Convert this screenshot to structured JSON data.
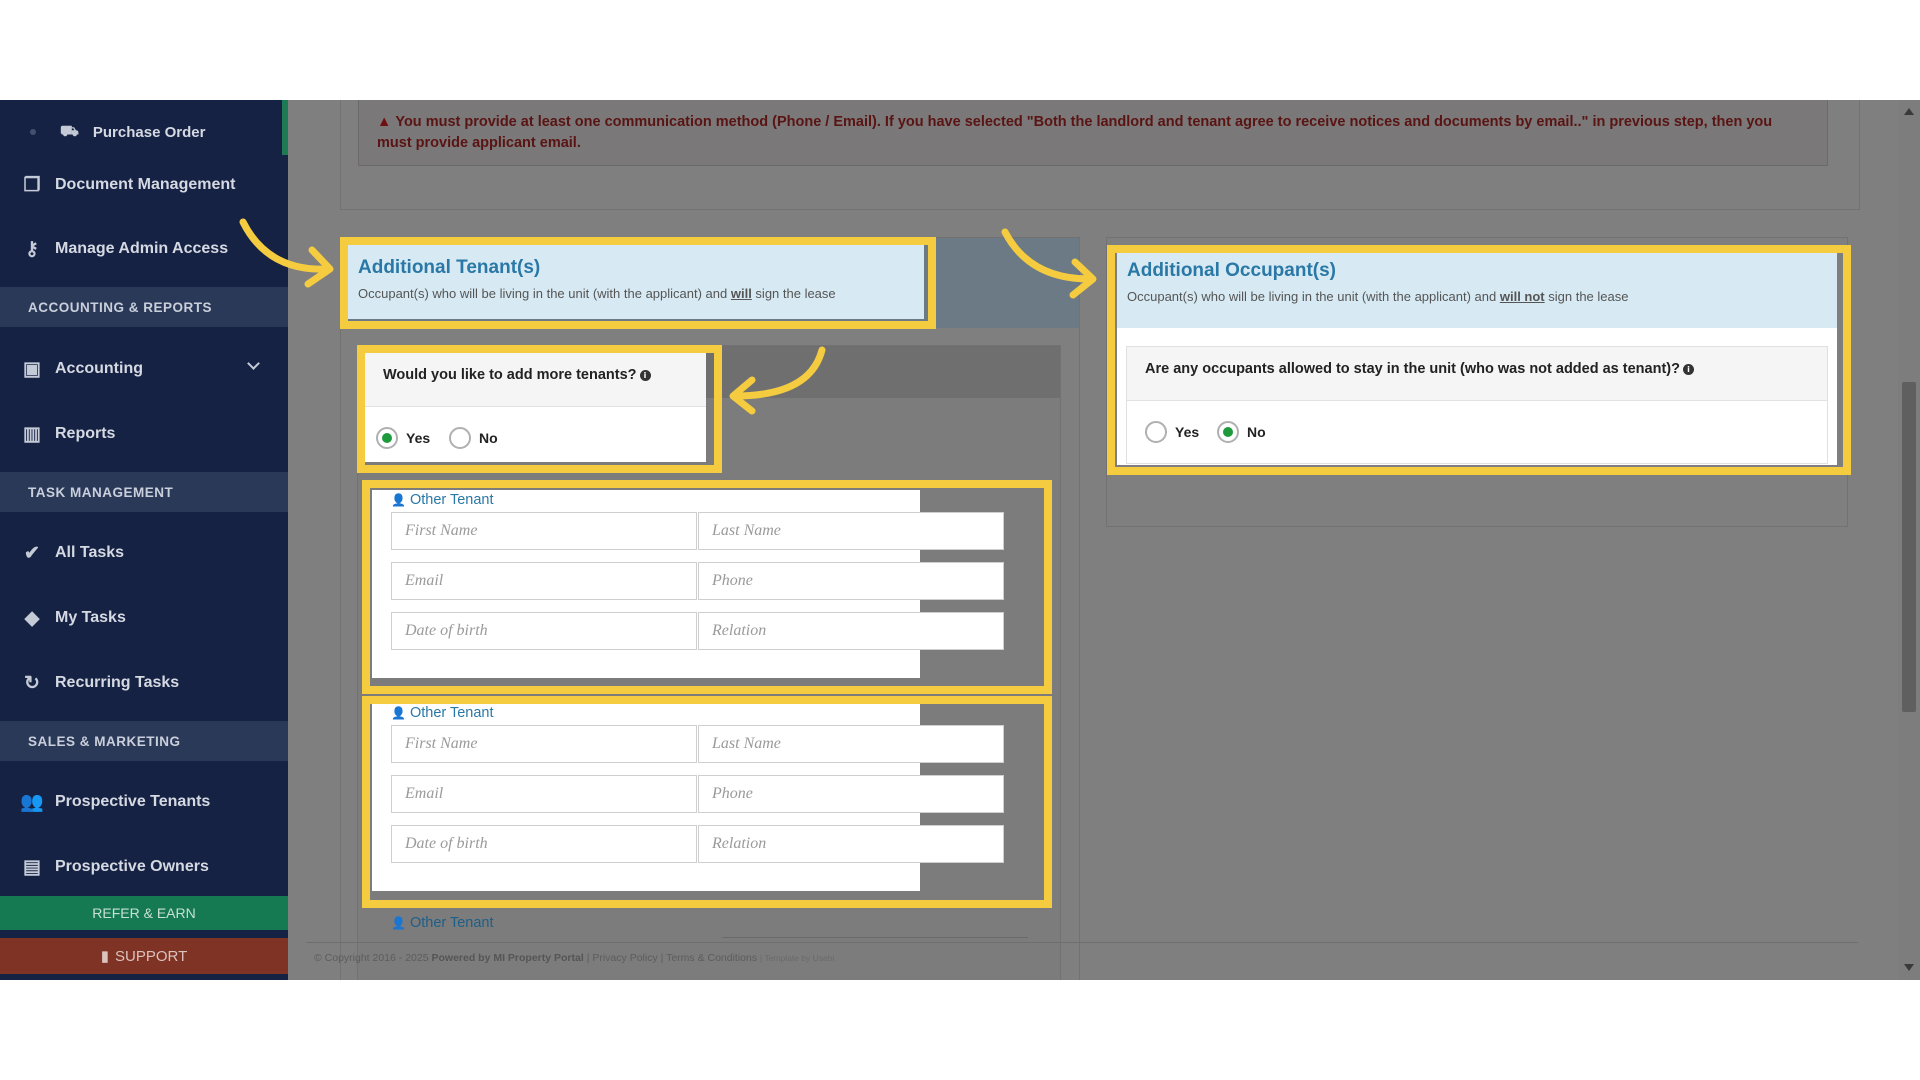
{
  "sidebar": {
    "purchase_order": "Purchase Order",
    "items": [
      {
        "label": "Document Management",
        "icon": "documents-icon"
      },
      {
        "label": "Manage Admin Access",
        "icon": "key-icon"
      },
      {
        "label": "Accounting",
        "icon": "money-icon"
      },
      {
        "label": "Reports",
        "icon": "bar-chart-icon"
      },
      {
        "label": "All Tasks",
        "icon": "check-icon"
      },
      {
        "label": "My Tasks",
        "icon": "tag-icon"
      },
      {
        "label": "Recurring Tasks",
        "icon": "refresh-icon"
      },
      {
        "label": "Prospective Tenants",
        "icon": "users-icon"
      },
      {
        "label": "Prospective Owners",
        "icon": "id-card-icon"
      }
    ],
    "sections": {
      "accounting": "ACCOUNTING & REPORTS",
      "tasks": "TASK MANAGEMENT",
      "sales": "SALES & MARKETING"
    },
    "refer": "REFER & EARN",
    "support": "SUPPORT"
  },
  "alert": {
    "text": "You must provide at least one communication method (Phone / Email). If you have selected \"Both the landlord and tenant agree to receive notices and documents by email..\" in previous step, then you must provide applicant email."
  },
  "tenants": {
    "title": "Additional Tenant(s)",
    "subtitle_pre": "Occupant(s) who will be living in the unit (with the applicant) and ",
    "subtitle_em": "will",
    "subtitle_post": " sign the lease",
    "question": "Would you like to add more tenants?",
    "yes": "Yes",
    "no": "No",
    "selected": "Yes",
    "block_label": "Other Tenant",
    "placeholders": {
      "first_name": "First Name",
      "last_name": "Last Name",
      "email": "Email",
      "phone": "Phone",
      "dob": "Date of birth",
      "relation": "Relation"
    }
  },
  "occupants": {
    "title": "Additional Occupant(s)",
    "subtitle_pre": "Occupant(s) who will be living in the unit (with the applicant) and ",
    "subtitle_em": "will not",
    "subtitle_post": " sign the lease",
    "question": "Are any occupants allowed to stay in the unit (who was not added as tenant)?",
    "yes": "Yes",
    "no": "No",
    "selected": "No"
  },
  "footer": {
    "copyright": "© Copyright 2016 - 2025",
    "powered": "Powered by MI Property Portal",
    "links": "| Privacy Policy | Terms & Conditions",
    "template": "| Template by Usebi"
  },
  "colors": {
    "highlight": "#f5cc40",
    "sidebar_bg": "#162244",
    "accent_blue": "#2a78a6",
    "radio_selected": "#1d9a3c"
  }
}
